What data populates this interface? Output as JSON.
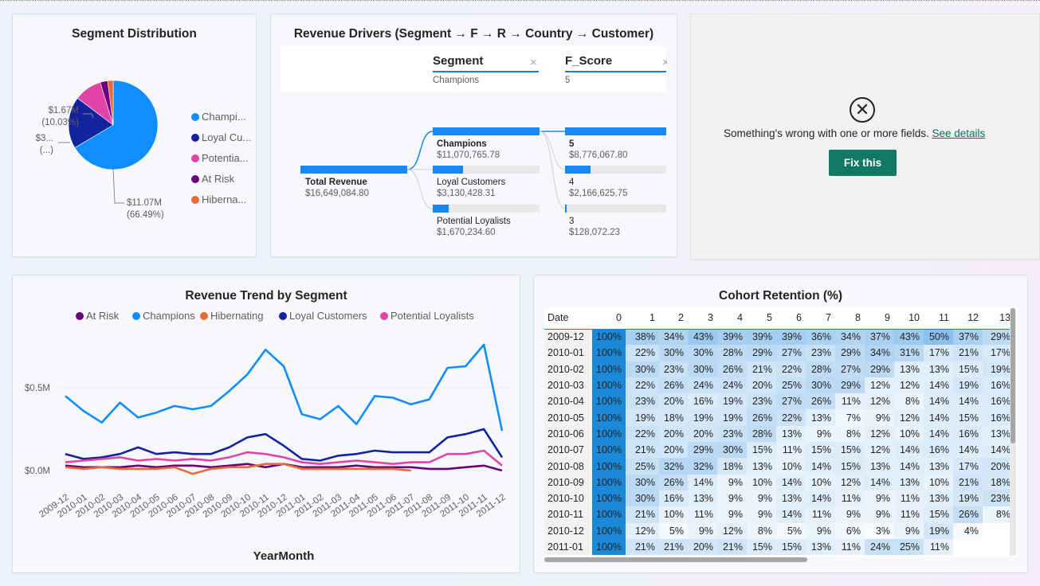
{
  "segment_distribution": {
    "title": "Segment Distribution",
    "legend": [
      "Champi...",
      "Loyal Cu...",
      "Potentia...",
      "At Risk",
      "Hiberna..."
    ],
    "labels": {
      "champions": [
        "$11.07M",
        "(66.49%)"
      ],
      "potential": [
        "$1.67M",
        "(10.03%)"
      ],
      "loyal": [
        "$3...",
        "(...)"
      ]
    },
    "colors": {
      "Champions": "#118dff",
      "Loyal Customers": "#12239e",
      "Potential Loyalists": "#e044a7",
      "At Risk": "#6b007b",
      "Hibernating": "#e66c37"
    },
    "chart_data": {
      "type": "pie",
      "categories": [
        "Champions",
        "Loyal Customers",
        "Potential Loyalists",
        "At Risk",
        "Hibernating"
      ],
      "values": [
        11.07,
        3.13,
        1.67,
        0.45,
        0.33
      ],
      "unit": "$M"
    }
  },
  "revenue_drivers": {
    "title": "Revenue Drivers (Segment → F → R → Country → Customer)",
    "columns": [
      {
        "header": "Segment",
        "selected": "Champions",
        "close": "×"
      },
      {
        "header": "F_Score",
        "selected": "5",
        "close": "×"
      }
    ],
    "root": {
      "label": "Total Revenue",
      "value": "$16,649,084.80",
      "fill": 1.0
    },
    "level1": [
      {
        "label": "Champions",
        "value": "$11,070,765.78",
        "fill": 1.0,
        "bold": true
      },
      {
        "label": "Loyal Customers",
        "value": "$3,130,428.31",
        "fill": 0.28
      },
      {
        "label": "Potential Loyalists",
        "value": "$1,670,234.60",
        "fill": 0.15
      }
    ],
    "level2": [
      {
        "label": "5",
        "value": "$8,776,067.80",
        "fill": 1.0,
        "bold": true
      },
      {
        "label": "4",
        "value": "$2,166,625.75",
        "fill": 0.25
      },
      {
        "label": "3",
        "value": "$128,072.23",
        "fill": 0.015
      }
    ]
  },
  "error_visual": {
    "icon": "⊗",
    "message": "Something's wrong with one or more fields.",
    "link": "See details",
    "button": "Fix this"
  },
  "revenue_trend": {
    "title": "Revenue Trend by Segment",
    "xlabel": "YearMonth",
    "y_ticks": [
      "$0.5M",
      "$0.0M"
    ],
    "chart_data": {
      "type": "line",
      "title": "Revenue Trend by Segment",
      "xlabel": "YearMonth",
      "ylabel": "",
      "ylim": [
        0,
        0.75
      ],
      "x": [
        "2009-12",
        "2010-01",
        "2010-02",
        "2010-03",
        "2010-04",
        "2010-05",
        "2010-06",
        "2010-07",
        "2010-08",
        "2010-09",
        "2010-10",
        "2010-11",
        "2010-12",
        "2011-01",
        "2011-02",
        "2011-03",
        "2011-04",
        "2011-05",
        "2011-06",
        "2011-07",
        "2011-08",
        "2011-09",
        "2011-10",
        "2011-11",
        "2011-12"
      ],
      "series": [
        {
          "name": "At Risk",
          "color": "#6b007b",
          "values": [
            0.03,
            0.02,
            0.02,
            0.02,
            0.03,
            0.02,
            0.03,
            0.03,
            0.02,
            0.03,
            0.04,
            0.02,
            0.04,
            0.02,
            0.02,
            0.02,
            0.03,
            0.02,
            0.02,
            0.02,
            0.01,
            0.01,
            0.02,
            0.03,
            0.0
          ]
        },
        {
          "name": "Champions",
          "color": "#118dff",
          "values": [
            0.45,
            0.36,
            0.29,
            0.41,
            0.32,
            0.35,
            0.39,
            0.37,
            0.39,
            0.48,
            0.58,
            0.73,
            0.63,
            0.34,
            0.31,
            0.39,
            0.28,
            0.45,
            0.44,
            0.4,
            0.43,
            0.62,
            0.63,
            0.76,
            0.24
          ]
        },
        {
          "name": "Hibernating",
          "color": "#e66c37",
          "values": [
            0.02,
            0.01,
            0.02,
            0.01,
            0.01,
            0.01,
            0.02,
            -0.02,
            0.01,
            0.02,
            0.02,
            0.04,
            0.04,
            0.01,
            0.01,
            0.01,
            0.01,
            0.01,
            0.01,
            0.0,
            null,
            null,
            null,
            null,
            null
          ]
        },
        {
          "name": "Loyal Customers",
          "color": "#12239e",
          "values": [
            0.1,
            0.07,
            0.08,
            0.1,
            0.14,
            0.1,
            0.11,
            0.1,
            0.1,
            0.14,
            0.2,
            0.22,
            0.15,
            0.07,
            0.06,
            0.09,
            0.1,
            0.12,
            0.11,
            0.11,
            0.11,
            0.2,
            0.22,
            0.25,
            0.08
          ]
        },
        {
          "name": "Potential Loyalists",
          "color": "#e044a7",
          "values": [
            0.05,
            0.06,
            0.07,
            0.08,
            0.06,
            0.07,
            0.06,
            0.07,
            0.06,
            0.08,
            0.11,
            0.1,
            0.08,
            0.05,
            0.04,
            0.05,
            0.06,
            0.05,
            0.04,
            0.05,
            0.05,
            0.1,
            0.1,
            0.12,
            0.03
          ]
        }
      ]
    }
  },
  "cohort_retention": {
    "title": "Cohort Retention (%)",
    "headers": [
      "Date",
      "0",
      "1",
      "2",
      "3",
      "4",
      "5",
      "6",
      "7",
      "8",
      "9",
      "10",
      "11",
      "12",
      "13"
    ],
    "rows": [
      [
        "2009-12",
        "100%",
        "38%",
        "34%",
        "43%",
        "39%",
        "39%",
        "39%",
        "36%",
        "34%",
        "37%",
        "43%",
        "50%",
        "37%",
        "29%"
      ],
      [
        "2010-01",
        "100%",
        "22%",
        "30%",
        "30%",
        "28%",
        "29%",
        "27%",
        "23%",
        "29%",
        "34%",
        "31%",
        "17%",
        "21%",
        "17%"
      ],
      [
        "2010-02",
        "100%",
        "30%",
        "23%",
        "30%",
        "26%",
        "21%",
        "22%",
        "28%",
        "27%",
        "29%",
        "13%",
        "13%",
        "15%",
        "19%"
      ],
      [
        "2010-03",
        "100%",
        "22%",
        "26%",
        "24%",
        "24%",
        "20%",
        "25%",
        "30%",
        "29%",
        "12%",
        "12%",
        "14%",
        "19%",
        "16%"
      ],
      [
        "2010-04",
        "100%",
        "23%",
        "20%",
        "16%",
        "19%",
        "23%",
        "27%",
        "26%",
        "11%",
        "12%",
        "8%",
        "14%",
        "14%",
        "16%"
      ],
      [
        "2010-05",
        "100%",
        "19%",
        "18%",
        "19%",
        "19%",
        "26%",
        "22%",
        "13%",
        "7%",
        "9%",
        "12%",
        "14%",
        "15%",
        "16%"
      ],
      [
        "2010-06",
        "100%",
        "22%",
        "20%",
        "20%",
        "23%",
        "28%",
        "13%",
        "9%",
        "8%",
        "12%",
        "10%",
        "14%",
        "16%",
        "13%"
      ],
      [
        "2010-07",
        "100%",
        "21%",
        "20%",
        "29%",
        "30%",
        "15%",
        "11%",
        "15%",
        "15%",
        "12%",
        "14%",
        "16%",
        "14%",
        "14%"
      ],
      [
        "2010-08",
        "100%",
        "25%",
        "32%",
        "32%",
        "18%",
        "13%",
        "10%",
        "14%",
        "15%",
        "13%",
        "14%",
        "13%",
        "17%",
        "20%"
      ],
      [
        "2010-09",
        "100%",
        "30%",
        "26%",
        "14%",
        "9%",
        "10%",
        "14%",
        "10%",
        "12%",
        "14%",
        "13%",
        "10%",
        "21%",
        "18%"
      ],
      [
        "2010-10",
        "100%",
        "30%",
        "16%",
        "13%",
        "9%",
        "9%",
        "13%",
        "14%",
        "11%",
        "9%",
        "11%",
        "13%",
        "19%",
        "23%"
      ],
      [
        "2010-11",
        "100%",
        "21%",
        "10%",
        "11%",
        "9%",
        "9%",
        "14%",
        "11%",
        "9%",
        "9%",
        "11%",
        "15%",
        "26%",
        "8%"
      ],
      [
        "2010-12",
        "100%",
        "12%",
        "5%",
        "9%",
        "12%",
        "8%",
        "5%",
        "9%",
        "6%",
        "3%",
        "9%",
        "19%",
        "4%",
        ""
      ],
      [
        "2011-01",
        "100%",
        "21%",
        "21%",
        "20%",
        "21%",
        "15%",
        "15%",
        "13%",
        "11%",
        "24%",
        "25%",
        "11%",
        "",
        ""
      ]
    ]
  }
}
